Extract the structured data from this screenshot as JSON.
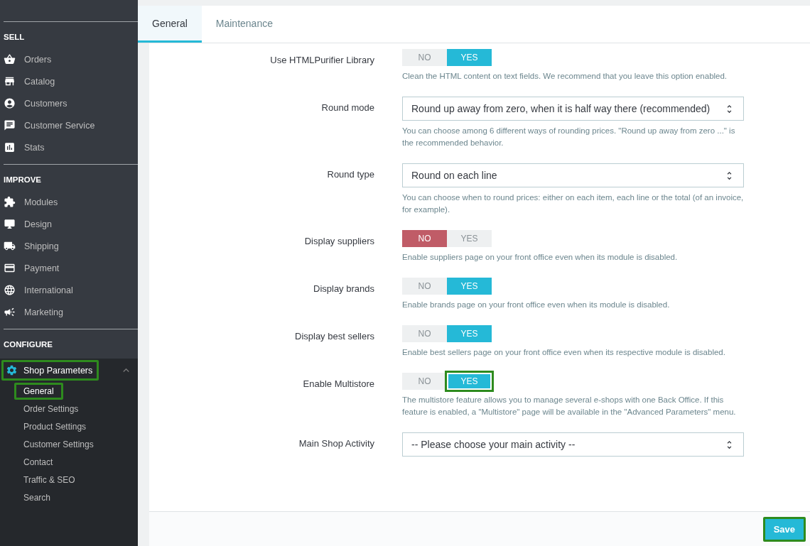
{
  "sidebar": {
    "sections": [
      {
        "title": "SELL",
        "items": [
          {
            "label": "Orders"
          },
          {
            "label": "Catalog"
          },
          {
            "label": "Customers"
          },
          {
            "label": "Customer Service"
          },
          {
            "label": "Stats"
          }
        ]
      },
      {
        "title": "IMPROVE",
        "items": [
          {
            "label": "Modules"
          },
          {
            "label": "Design"
          },
          {
            "label": "Shipping"
          },
          {
            "label": "Payment"
          },
          {
            "label": "International"
          },
          {
            "label": "Marketing"
          }
        ]
      },
      {
        "title": "CONFIGURE",
        "items": [
          {
            "label": "Shop Parameters",
            "selected": true,
            "expanded": true,
            "highlighted": true,
            "children": [
              {
                "label": "General",
                "selected": true,
                "highlighted": true
              },
              {
                "label": "Order Settings",
                "selected": false,
                "highlighted": false
              },
              {
                "label": "Product Settings",
                "selected": false,
                "highlighted": false
              },
              {
                "label": "Customer Settings",
                "selected": false,
                "highlighted": false
              },
              {
                "label": "Contact",
                "selected": false,
                "highlighted": false
              },
              {
                "label": "Traffic & SEO",
                "selected": false,
                "highlighted": false
              },
              {
                "label": "Search",
                "selected": false,
                "highlighted": false
              }
            ]
          }
        ]
      }
    ]
  },
  "tabs": [
    {
      "label": "General",
      "selected": true
    },
    {
      "label": "Maintenance",
      "selected": false
    }
  ],
  "form": {
    "fields": [
      {
        "kind": "switch",
        "label": "Use HTMLPurifier Library",
        "no": "NO",
        "yes": "YES",
        "on": true,
        "highlighted": false,
        "help": "Clean the HTML content on text fields. We recommend that you leave this option enabled."
      },
      {
        "kind": "select",
        "label": "Round mode",
        "value": "Round up away from zero, when it is half way there (recommended)",
        "help": "You can choose among 6 different ways of rounding prices. \"Round up away from zero ...\" is the recommended behavior."
      },
      {
        "kind": "select",
        "label": "Round type",
        "value": "Round on each line",
        "help": "You can choose when to round prices: either on each item, each line or the total (of an invoice, for example)."
      },
      {
        "kind": "switch",
        "label": "Display suppliers",
        "no": "NO",
        "yes": "YES",
        "on": false,
        "highlighted": false,
        "help": "Enable suppliers page on your front office even when its module is disabled."
      },
      {
        "kind": "switch",
        "label": "Display brands",
        "no": "NO",
        "yes": "YES",
        "on": true,
        "highlighted": false,
        "help": "Enable brands page on your front office even when its module is disabled."
      },
      {
        "kind": "switch",
        "label": "Display best sellers",
        "no": "NO",
        "yes": "YES",
        "on": true,
        "highlighted": false,
        "help": "Enable best sellers page on your front office even when its respective module is disabled."
      },
      {
        "kind": "switch",
        "label": "Enable Multistore",
        "no": "NO",
        "yes": "YES",
        "on": true,
        "highlighted": true,
        "help": "The multistore feature allows you to manage several e-shops with one Back Office. If this feature is enabled, a \"Multistore\" page will be available in the \"Advanced Parameters\" menu."
      },
      {
        "kind": "select",
        "label": "Main Shop Activity",
        "value": "-- Please choose your main activity --"
      }
    ],
    "save": {
      "label": "Save",
      "highlighted": true
    }
  }
}
